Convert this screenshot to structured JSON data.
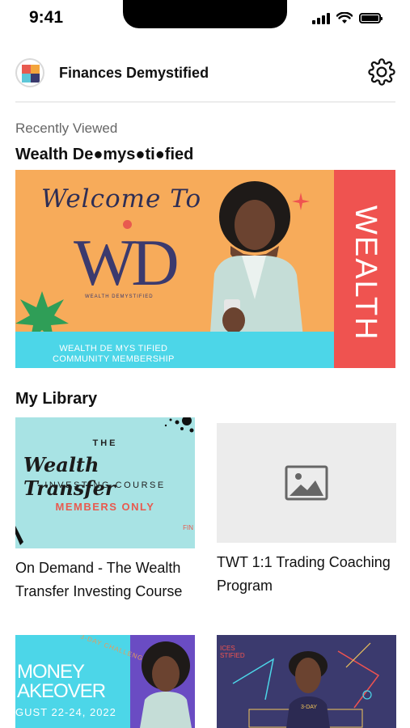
{
  "status_bar": {
    "time": "9:41"
  },
  "header": {
    "title": "Finances Demystified",
    "settings_icon": "gear-icon"
  },
  "recent": {
    "label": "Recently Viewed",
    "title": "Wealth De●mys●ti●fied",
    "banner": {
      "welcome": "Welcome To",
      "monogram": "WD",
      "tagline": "WEALTH DEMYSTIFIED",
      "band_line1": "WEALTH DE MYS TIFIED",
      "band_line2": "COMMUNITY MEMBERSHIP",
      "side_text": "WEALTH"
    }
  },
  "library": {
    "title": "My Library",
    "items": [
      {
        "caption": "On Demand - The Wealth Transfer Investing Course",
        "thumb": {
          "the": "THE",
          "title": "Wealth Transfer",
          "subtitle": "INVESTING COURSE",
          "badge": "MEMBERS ONLY",
          "corner": "FIN"
        }
      },
      {
        "caption": "TWT 1:1 Trading Coaching Program",
        "thumb": {
          "placeholder_icon": "image-placeholder-icon"
        }
      },
      {
        "thumb": {
          "headline_line1": "MONEY",
          "headline_line2": "AKEOVER",
          "date": "GUST 22-24, 2022",
          "badge": "3-DAY CHALLENGE"
        }
      },
      {
        "thumb": {
          "label_line1": "ICES",
          "label_line2": "STIFIED",
          "day": "3-DAY"
        }
      }
    ]
  },
  "colors": {
    "orange": "#f7ab5a",
    "coral": "#ef5350",
    "cyan": "#4cd6e8",
    "navy": "#3b3a6e",
    "mint": "#a8e3e4",
    "purple": "#6a4cc3"
  }
}
